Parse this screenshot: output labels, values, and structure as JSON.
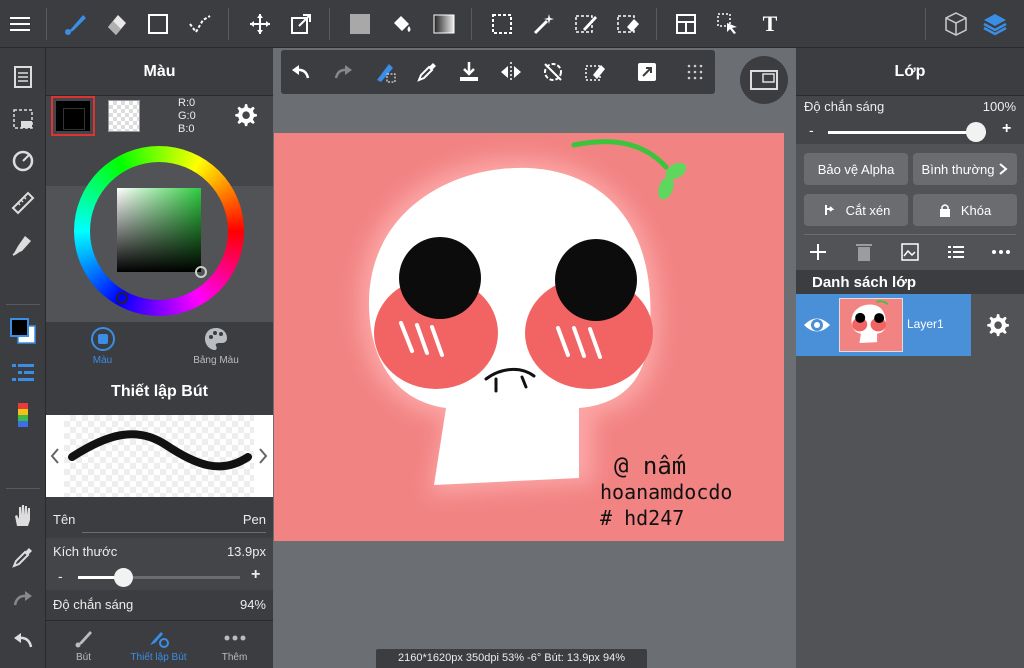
{
  "color_panel": {
    "title": "Màu",
    "rgb": {
      "r": "R:0",
      "g": "G:0",
      "b": "B:0"
    },
    "tabs": [
      {
        "label": "Màu"
      },
      {
        "label": "Bảng Màu"
      }
    ]
  },
  "brush_settings": {
    "title": "Thiết lập Bút",
    "name_label": "Tên",
    "name_value": "Pen",
    "size_label": "Kích thước",
    "size_value": "13.9px",
    "size_fraction": 0.25,
    "opacity_label": "Độ chắn sáng",
    "opacity_value": "94%",
    "minus": "-",
    "plus": "+"
  },
  "bottom_tabs": [
    {
      "label": "Bút"
    },
    {
      "label": "Thiết lập Bút"
    },
    {
      "label": "Thêm"
    }
  ],
  "status_bar": {
    "text": "2160*1620px 350dpi 53% -6° Bút: 13.9px 94%"
  },
  "artwork": {
    "signature_lines": [
      "@ nấm",
      "hoanamdocdo",
      "# hd247"
    ]
  },
  "layer_panel": {
    "title": "Lớp",
    "opacity_label": "Độ chắn sáng",
    "opacity_value": "100%",
    "opacity_fraction": 1.0,
    "minus": "-",
    "plus": "+",
    "alpha_protect": "Bảo vệ Alpha",
    "blend_mode": "Bình thường",
    "clipping": "Cắt xén",
    "lock": "Khóa",
    "list_title": "Danh sách lớp",
    "layers": [
      {
        "name": "Layer1"
      }
    ]
  },
  "toolbar": {
    "text_tool": "T"
  },
  "colors": {
    "accent": "#3a8ee6",
    "selected_layer": "#4a90d9",
    "panel_dark": "#3c3d40",
    "panel_mid": "#525356",
    "canvas_bg": "#6b6e72",
    "art_bg": "#f28383"
  }
}
